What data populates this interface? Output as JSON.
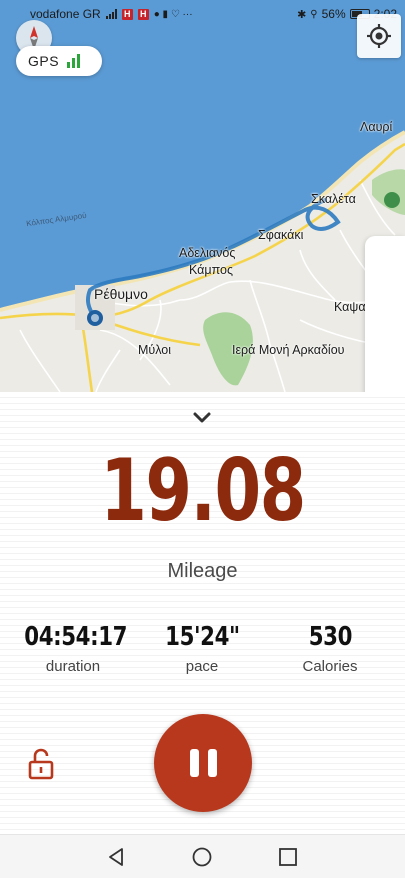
{
  "status_bar": {
    "carrier": "vodafone GR",
    "battery": "56%",
    "time": "2:02",
    "badge_letter": "H"
  },
  "map": {
    "gps_label": "GPS",
    "places": {
      "lavrio": "Λαυρί",
      "skaleta": "Σκαλέτα",
      "sfakaki": "Σφακάκι",
      "adelianos_1": "Αδελιανός",
      "adelianos_2": "Κάμπος",
      "rethymno": "Ρέθυμνο",
      "kaspaliana": "Καψαλιανά",
      "myloi": "Μύλοι",
      "monastery": "Ιερά Μονή Αρκαδίου",
      "gulf": "Κόλπος Αλμυρού"
    },
    "colors": {
      "sea": "#5b9bd5",
      "land": "#ecebe6",
      "route": "#2e7bc0"
    }
  },
  "stats": {
    "mileage_value": "19.08",
    "mileage_label": "Mileage",
    "duration_value": "04:54:17",
    "duration_label": "duration",
    "pace_value": "15'24\"",
    "pace_label": "pace",
    "calories_value": "530",
    "calories_label": "Calories",
    "accent_color": "#8c2a0e",
    "button_color": "#b8381d"
  }
}
